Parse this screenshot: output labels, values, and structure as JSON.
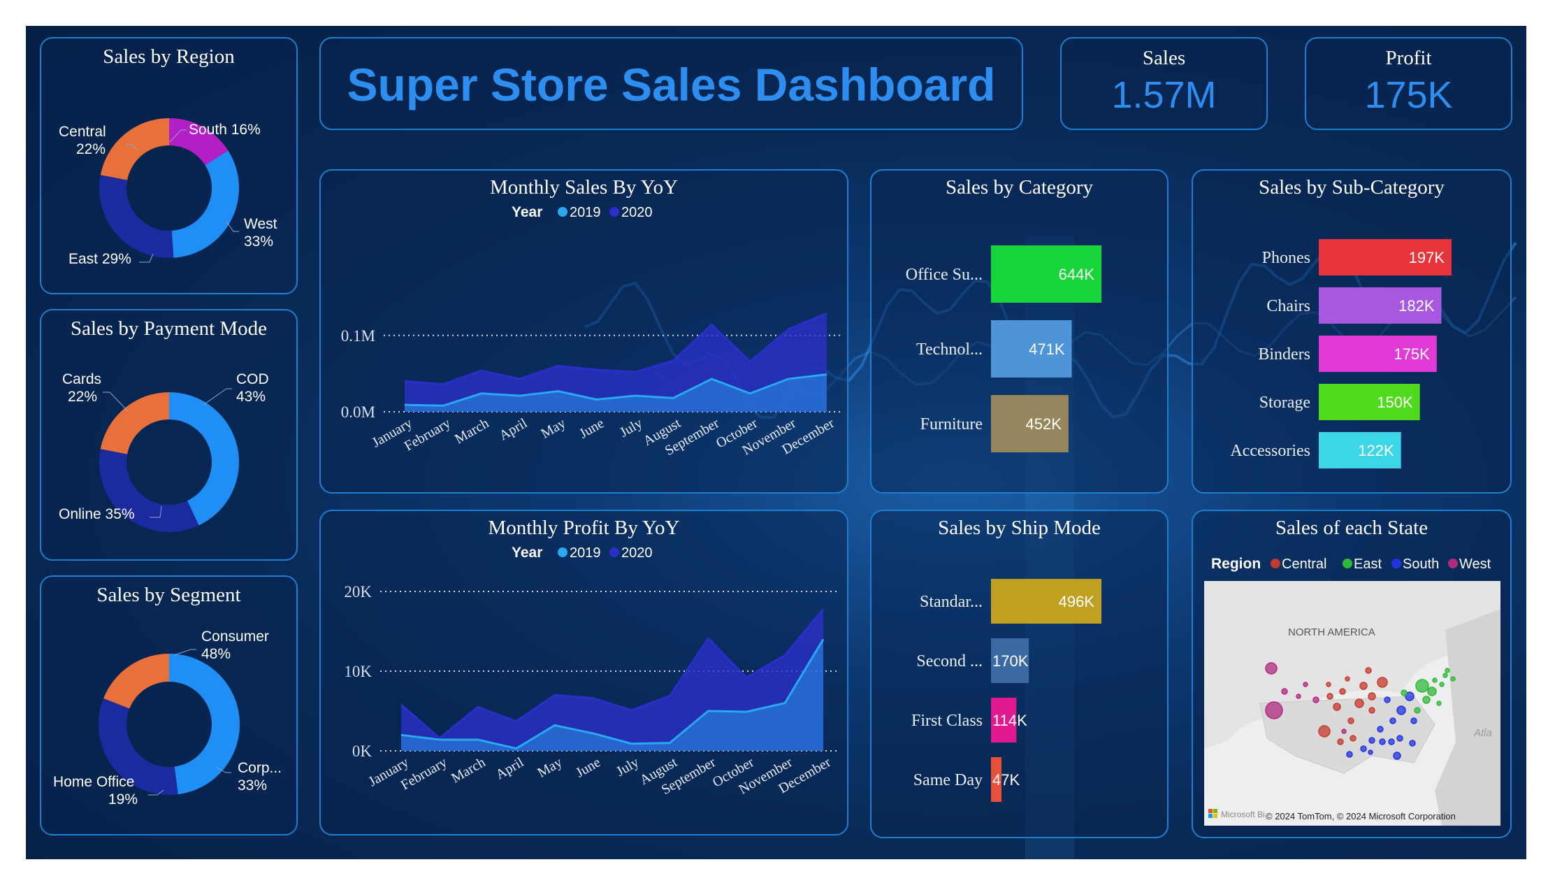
{
  "header": {
    "title": "Super Store Sales Dashboard"
  },
  "kpis": {
    "sales": {
      "label": "Sales",
      "value": "1.57M"
    },
    "profit": {
      "label": "Profit",
      "value": "175K"
    }
  },
  "colors": {
    "accent": "#1e7fd0",
    "y2019": "#29a9f0",
    "y2020": "#2b2fc8",
    "orange": "#e8703a",
    "purple": "#b21fc4",
    "blue": "#1f8ef5",
    "navy": "#1c2aa0"
  },
  "donuts": {
    "region": {
      "title": "Sales by Region",
      "slices": [
        {
          "name": "South",
          "pct": 16,
          "color": "#b21fc4"
        },
        {
          "name": "West",
          "pct": 33,
          "color": "#1f8ef5"
        },
        {
          "name": "East",
          "pct": 29,
          "color": "#1c2aa0"
        },
        {
          "name": "Central",
          "pct": 22,
          "color": "#e8703a"
        }
      ]
    },
    "payment": {
      "title": "Sales by Payment Mode",
      "slices": [
        {
          "name": "COD",
          "pct": 43,
          "color": "#1f8ef5"
        },
        {
          "name": "Online",
          "pct": 35,
          "color": "#1c2aa0"
        },
        {
          "name": "Cards",
          "pct": 22,
          "color": "#e8703a"
        }
      ]
    },
    "segment": {
      "title": "Sales by Segment",
      "slices": [
        {
          "name": "Consumer",
          "pct": 48,
          "color": "#1f8ef5"
        },
        {
          "name": "Corp...",
          "pct": 33,
          "color": "#1c2aa0"
        },
        {
          "name": "Home Office",
          "pct": 19,
          "color": "#e8703a"
        }
      ]
    }
  },
  "chart_data": [
    {
      "id": "monthly_sales",
      "type": "area",
      "title": "Monthly Sales By YoY",
      "legend_title": "Year",
      "categories": [
        "January",
        "February",
        "March",
        "April",
        "May",
        "June",
        "July",
        "August",
        "September",
        "October",
        "November",
        "December"
      ],
      "series": [
        {
          "name": "2019",
          "color": "#29a9f0",
          "values": [
            0.009,
            0.008,
            0.024,
            0.021,
            0.027,
            0.016,
            0.021,
            0.018,
            0.043,
            0.024,
            0.043,
            0.049
          ]
        },
        {
          "name": "2020",
          "color": "#2b2fc8",
          "values": [
            0.04,
            0.036,
            0.054,
            0.043,
            0.06,
            0.055,
            0.052,
            0.067,
            0.114,
            0.066,
            0.108,
            0.129
          ]
        }
      ],
      "yticks": [
        "0.0M",
        "0.1M"
      ],
      "yticks_values": [
        0,
        0.1
      ],
      "ylim": [
        0,
        0.13
      ],
      "grid": true,
      "legend": "top-center"
    },
    {
      "id": "monthly_profit",
      "type": "area",
      "title": "Monthly Profit By YoY",
      "legend_title": "Year",
      "categories": [
        "January",
        "February",
        "March",
        "April",
        "May",
        "June",
        "July",
        "August",
        "September",
        "October",
        "November",
        "December"
      ],
      "series": [
        {
          "name": "2019",
          "color": "#29a9f0",
          "values": [
            2000,
            1400,
            1400,
            300,
            3200,
            2200,
            900,
            1000,
            5000,
            4900,
            6000,
            14000
          ]
        },
        {
          "name": "2020",
          "color": "#2b2fc8",
          "values": [
            5800,
            1600,
            5500,
            3700,
            7000,
            6600,
            5100,
            6900,
            14100,
            9200,
            12000,
            17800
          ]
        }
      ],
      "yticks": [
        "0K",
        "10K",
        "20K"
      ],
      "yticks_values": [
        0,
        10000,
        20000
      ],
      "ylim": [
        0,
        20000
      ],
      "grid": true,
      "legend": "top-center"
    },
    {
      "id": "category",
      "type": "bar",
      "title": "Sales by Category",
      "categories": [
        "Office Su...",
        "Technol...",
        "Furniture"
      ],
      "values": [
        644,
        471,
        452
      ],
      "labels": [
        "644K",
        "471K",
        "452K"
      ],
      "colors": [
        "#18d63a",
        "#4d94d8",
        "#97855e"
      ]
    },
    {
      "id": "subcategory",
      "type": "bar",
      "title": "Sales by Sub-Category",
      "categories": [
        "Phones",
        "Chairs",
        "Binders",
        "Storage",
        "Accessories"
      ],
      "values": [
        197,
        182,
        175,
        150,
        122
      ],
      "labels": [
        "197K",
        "182K",
        "175K",
        "150K",
        "122K"
      ],
      "colors": [
        "#e8333a",
        "#a858e0",
        "#e23ad6",
        "#4fdb1c",
        "#3cd6e6"
      ]
    },
    {
      "id": "shipmode",
      "type": "bar",
      "title": "Sales by Ship Mode",
      "categories": [
        "Standar...",
        "Second ...",
        "First Class",
        "Same Day"
      ],
      "values": [
        496,
        170,
        114,
        47
      ],
      "labels": [
        "496K",
        "170K",
        "114K",
        "47K"
      ],
      "colors": [
        "#bfa020",
        "#3b69a3",
        "#e0198f",
        "#e8503a"
      ]
    }
  ],
  "map": {
    "title": "Sales of each State",
    "legend_title": "Region",
    "legend": [
      {
        "name": "Central",
        "color": "#c53a2e"
      },
      {
        "name": "East",
        "color": "#2fb93a"
      },
      {
        "name": "South",
        "color": "#2233e0"
      },
      {
        "name": "West",
        "color": "#b02a80"
      }
    ],
    "continent_label": "NORTH AMERICA",
    "ocean_label": "Atla",
    "brand": "Microsoft Bi",
    "copyright": "© 2024 TomTom, © 2024 Microsoft Corporation"
  }
}
